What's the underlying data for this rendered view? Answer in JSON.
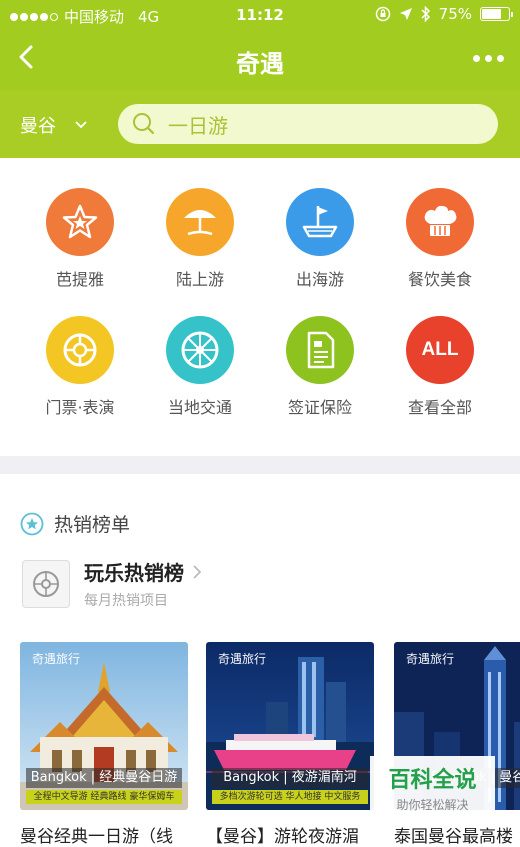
{
  "status": {
    "carrier": "中国移动",
    "network": "4G",
    "time": "11:12",
    "battery_text": "75%",
    "battery_level": 0.75
  },
  "nav": {
    "title": "奇遇"
  },
  "search": {
    "city": "曼谷",
    "placeholder": "一日游"
  },
  "categories": [
    {
      "label": "芭提雅",
      "icon": "star-icon",
      "color": "#f07a3a"
    },
    {
      "label": "陆上游",
      "icon": "beach-umbrella-icon",
      "color": "#f7a62c"
    },
    {
      "label": "出海游",
      "icon": "boat-icon",
      "color": "#3b9be8"
    },
    {
      "label": "餐饮美食",
      "icon": "chef-hat-icon",
      "color": "#f06a35"
    },
    {
      "label": "门票·表演",
      "icon": "ticket-wheel-icon",
      "color": "#f3c623"
    },
    {
      "label": "当地交通",
      "icon": "wheel-icon",
      "color": "#35c3c9"
    },
    {
      "label": "签证保险",
      "icon": "document-icon",
      "color": "#8ec21f"
    },
    {
      "label": "查看全部",
      "icon": "all-icon",
      "color": "#e8412c",
      "icon_text": "ALL"
    }
  ],
  "hot": {
    "section_title": "热销榜单",
    "list_title": "玩乐热销榜",
    "list_subtitle": "每月热销项目"
  },
  "products": [
    {
      "brand": "奇遇旅行",
      "tagline": "Bangkok | 经典曼谷日游",
      "subtag": "全程中文导游 经典路线 豪华保姆车",
      "name": "曼谷经典一日游（线"
    },
    {
      "brand": "奇遇旅行",
      "tagline": "Bangkok | 夜游湄南河",
      "subtag": "多档次游轮可选 华人地接 中文服务",
      "name": "【曼谷】游轮夜游湄"
    },
    {
      "brand": "奇遇旅行",
      "tagline": "Bangkok | 曼谷",
      "subtag": "",
      "name": "泰国曼谷最高楼"
    }
  ],
  "watermark": {
    "line1": "百科全说",
    "line2": "助你轻松解决"
  },
  "colors": {
    "brand_green": "#a2cc1f",
    "search_bg": "#f3f9cf"
  }
}
